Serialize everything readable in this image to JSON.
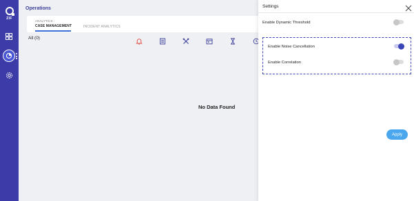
{
  "sidebar": {
    "logo_text": "ZIF",
    "items": [
      {
        "icon": "dashboard-grid-icon"
      },
      {
        "icon": "analytics-pie-icon",
        "active": true
      },
      {
        "icon": "gear-icon"
      }
    ],
    "accent": "#3c3ba8"
  },
  "main": {
    "title": "Operations",
    "tabs": [
      {
        "sub": "ANALYTICS :",
        "label": "CASE MANAGEMENT",
        "active": true
      },
      {
        "label": "INCIDENT ANALYTICS",
        "active": false
      }
    ],
    "count_label": "All (0)",
    "toolbar_icons": [
      "bell-icon",
      "list-icon",
      "tools-icon",
      "calendar-icon",
      "hourglass-icon",
      "clock-icon"
    ],
    "empty_message": "No Data Found"
  },
  "settings": {
    "title": "Settings",
    "options": [
      {
        "label": "Enable Dynamic Threshold",
        "enabled": false
      },
      {
        "label": "Enable Noise Cancellation",
        "enabled": true
      },
      {
        "label": "Enable Correlation",
        "enabled": false
      }
    ],
    "apply_label": "Apply",
    "apply_color": "#4aa7ee",
    "toggle_on_color": "#3a44b6"
  }
}
